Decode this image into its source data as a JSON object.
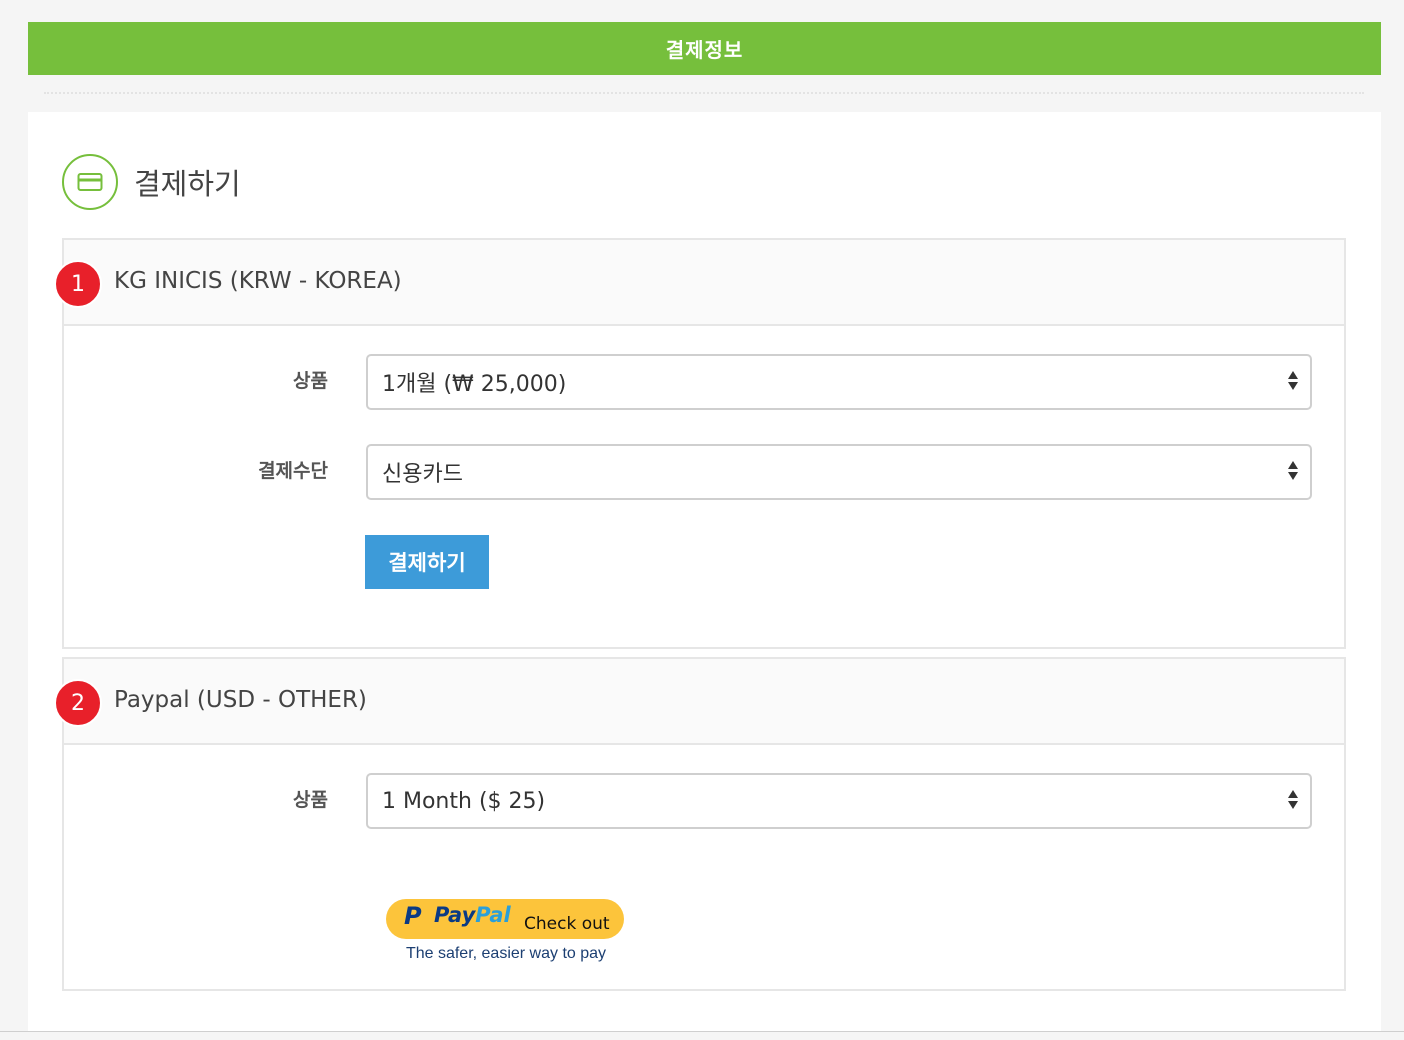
{
  "header": {
    "title": "결제정보"
  },
  "section": {
    "title": "결제하기",
    "icon": "credit-card-icon"
  },
  "panels": [
    {
      "badge": "1",
      "title": "KG INICIS (KRW - KOREA)",
      "product_label": "상품",
      "product_value": "1개월 (₩ 25,000)",
      "method_label": "결제수단",
      "method_value": "신용카드",
      "submit_label": "결제하기"
    },
    {
      "badge": "2",
      "title": "Paypal (USD - OTHER)",
      "product_label": "상품",
      "product_value": "1 Month ($ 25)",
      "paypal": {
        "logo_p": "P",
        "logo_pay": "Pay",
        "logo_pal": "Pal",
        "checkout": "Check out",
        "tagline": "The safer, easier way to pay"
      }
    }
  ],
  "colors": {
    "accent_green": "#76bf3c",
    "button_blue": "#3d9bd9",
    "badge_red": "#e8202a",
    "paypal_yellow": "#fcc43b"
  }
}
